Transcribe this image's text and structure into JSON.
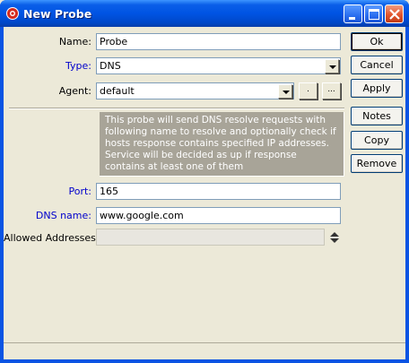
{
  "window": {
    "title": "New Probe",
    "icons": {
      "app": "probe-app-icon",
      "minimize": "minimize-icon",
      "maximize": "maximize-icon",
      "close": "close-icon"
    }
  },
  "form": {
    "name": {
      "label": "Name:",
      "value": "Probe"
    },
    "type": {
      "label": "Type:",
      "value": "DNS"
    },
    "agent": {
      "label": "Agent:",
      "value": "default",
      "small_button_1": ".",
      "small_button_2": "..."
    },
    "info_text": "This probe will send DNS resolve requests with following name to resolve and optionally check if hosts response contains specified IP addresses. Service will be decided as up if response contains at least one of them",
    "port": {
      "label": "Port:",
      "value": "165"
    },
    "dns_name": {
      "label": "DNS name:",
      "value": "www.google.com"
    },
    "allowed_addresses": {
      "label": "Allowed Addresses:",
      "value": ""
    }
  },
  "buttons": {
    "ok": "Ok",
    "cancel": "Cancel",
    "apply": "Apply",
    "notes": "Notes",
    "copy": "Copy",
    "remove": "Remove"
  },
  "colors": {
    "titlebar": "#0054e3",
    "blue_label": "#0000cc",
    "info_bg": "#a8a498"
  }
}
